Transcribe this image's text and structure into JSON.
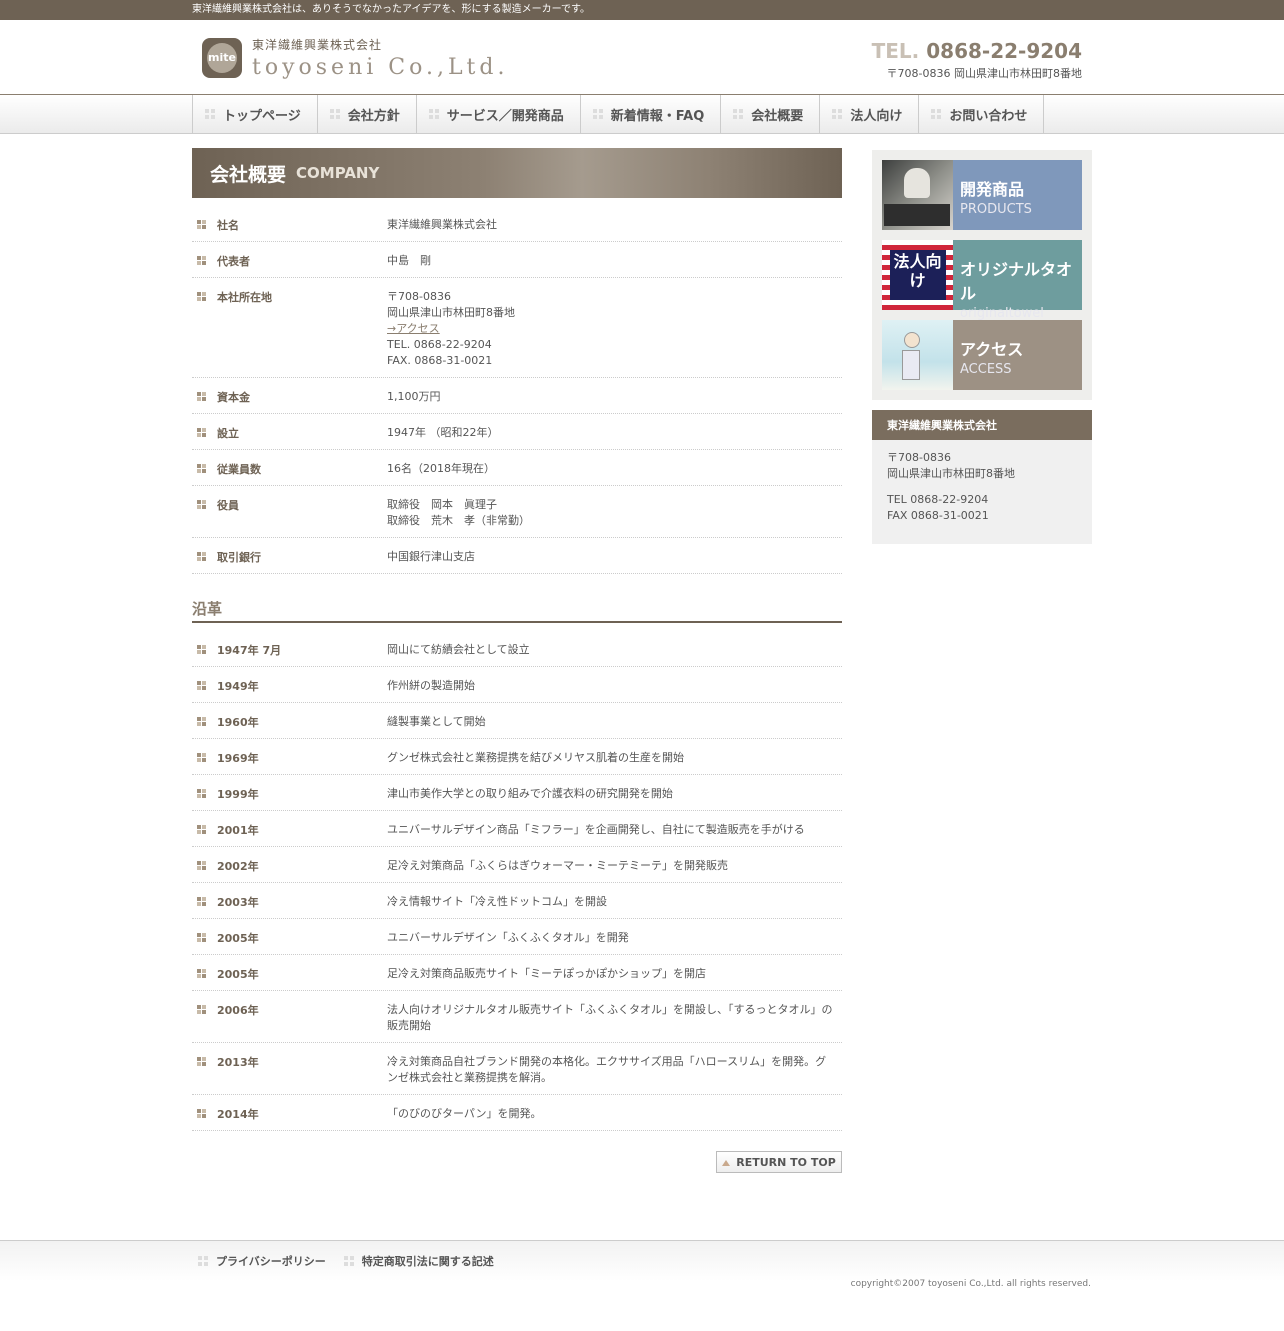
{
  "topbar": {
    "text": "東洋繊維興業株式会社は、ありそうでなかったアイデアを、形にする製造メーカーです。"
  },
  "header": {
    "logo_mark": "mite",
    "logo_jp": "東洋繊維興業株式会社",
    "logo_en": "toyoseni Co.,Ltd.",
    "tel_label": "TEL.",
    "tel": "0868-22-9204",
    "address": "〒708-0836 岡山県津山市林田町8番地"
  },
  "nav": {
    "items": [
      "トップページ",
      "会社方針",
      "サービス／開発商品",
      "新着情報・FAQ",
      "会社概要",
      "法人向け",
      "お問い合わせ"
    ]
  },
  "page_title": {
    "jp": "会社概要",
    "en": "COMPANY"
  },
  "company_info": [
    {
      "label": "社名",
      "lines": [
        "東洋繊維興業株式会社"
      ]
    },
    {
      "label": "代表者",
      "lines": [
        "中島　剛"
      ]
    },
    {
      "label": "本社所在地",
      "lines": [
        "〒708-0836",
        "岡山県津山市林田町8番地"
      ],
      "link": "→アクセス",
      "lines2": [
        "TEL. 0868-22-9204",
        "FAX. 0868-31-0021"
      ]
    },
    {
      "label": "資本金",
      "lines": [
        "1,100万円"
      ]
    },
    {
      "label": "設立",
      "lines": [
        "1947年 （昭和22年）"
      ]
    },
    {
      "label": "従業員数",
      "lines": [
        "16名（2018年現在）"
      ]
    },
    {
      "label": "役員",
      "lines": [
        "取締役　岡本　眞理子",
        "取締役　荒木　孝（非常勤）"
      ]
    },
    {
      "label": "取引銀行",
      "lines": [
        "中国銀行津山支店"
      ]
    }
  ],
  "history_title": "沿革",
  "history": [
    {
      "year": "1947年 7月",
      "text": "岡山にて紡績会社として設立"
    },
    {
      "year": "1949年",
      "text": "作州絣の製造開始"
    },
    {
      "year": "1960年",
      "text": "縫製事業として開始"
    },
    {
      "year": "1969年",
      "text": "グンゼ株式会社と業務提携を結びメリヤス肌着の生産を開始"
    },
    {
      "year": "1999年",
      "text": "津山市美作大学との取り組みで介護衣料の研究開発を開始"
    },
    {
      "year": "2001年",
      "text": "ユニバーサルデザイン商品「ミフラー」を企画開発し、自社にて製造販売を手がける"
    },
    {
      "year": "2002年",
      "text": "足冷え対策商品「ふくらはぎウォーマー・ミーテミーテ」を開発販売"
    },
    {
      "year": "2003年",
      "text": "冷え情報サイト「冷え性ドットコム」を開設"
    },
    {
      "year": "2005年",
      "text": "ユニバーサルデザイン「ふくふくタオル」を開発"
    },
    {
      "year": "2005年",
      "text": "足冷え対策商品販売サイト「ミーテぽっかぽかショップ」を開店"
    },
    {
      "year": "2006年",
      "text": "法人向けオリジナルタオル販売サイト「ふくふくタオル」を開設し、「するっとタオル」の販売開始"
    },
    {
      "year": "2013年",
      "text": "冷え対策商品自社ブランド開発の本格化。エクササイズ用品「ハロースリム」を開発。グンゼ株式会社と業務提携を解消。"
    },
    {
      "year": "2014年",
      "text": "「のびのびターパン」を開発。"
    }
  ],
  "return_to_top": "RETURN TO TOP",
  "sidebar": {
    "banners": [
      {
        "title": "開発商品",
        "sub": "PRODUCTS"
      },
      {
        "title": "オリジナルタオル",
        "sub": "originaltowel",
        "image_text": "法人向け"
      },
      {
        "title": "アクセス",
        "sub": "ACCESS"
      }
    ],
    "company_box": {
      "title": "東洋繊維興業株式会社",
      "postal": "〒708-0836",
      "address": "岡山県津山市林田町8番地",
      "tel": "TEL 0868-22-9204",
      "fax": "FAX 0868-31-0021"
    }
  },
  "footer": {
    "links": [
      "プライバシーポリシー",
      "特定商取引法に関する記述"
    ],
    "copyright": "copyright©2007 toyoseni Co.,Ltd. all rights reserved."
  },
  "colors": {
    "brand_brown": "#6e6254",
    "products_blue": "#7f98bb",
    "towel_teal": "#6e9d9e",
    "access_taupe": "#9d9184"
  }
}
